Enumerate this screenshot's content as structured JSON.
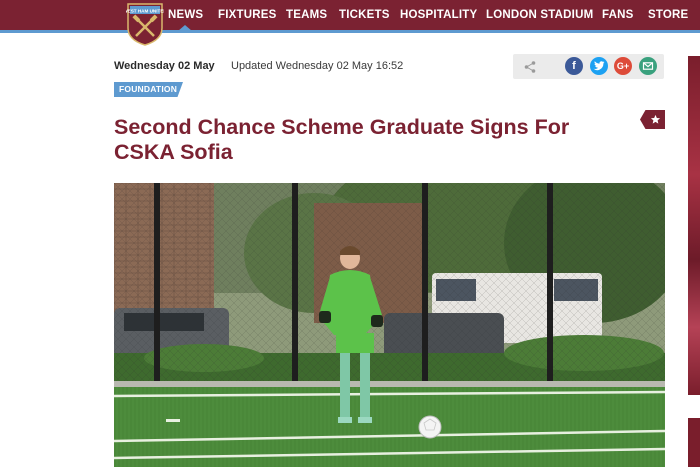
{
  "nav": {
    "crest_text": "WEST HAM UNITED",
    "items": [
      {
        "label": "NEWS",
        "active": true
      },
      {
        "label": "FIXTURES"
      },
      {
        "label": "TEAMS"
      },
      {
        "label": "TICKETS"
      },
      {
        "label": "HOSPITALITY"
      },
      {
        "label": "LONDON STADIUM"
      },
      {
        "label": "FANS"
      },
      {
        "label": "STORE"
      }
    ]
  },
  "article": {
    "date": "Wednesday 02 May",
    "updated": "Updated Wednesday 02 May 16:52",
    "category": "FOUNDATION",
    "title": "Second Chance Scheme Graduate Signs For CSKA Sofia"
  },
  "share": {
    "icons": [
      "share-icon",
      "facebook-icon",
      "twitter-icon",
      "google-plus-icon",
      "email-icon"
    ],
    "facebook_glyph": "f",
    "google_glyph": "G+"
  },
  "colors": {
    "claret": "#7b2232",
    "sky_blue": "#5e9ad0",
    "facebook": "#3b5998",
    "twitter": "#1da1f2",
    "google": "#dd4b39",
    "email": "#3aa17e",
    "pitch_green": "#4d8c3c",
    "kit_green": "#5cc24a"
  }
}
